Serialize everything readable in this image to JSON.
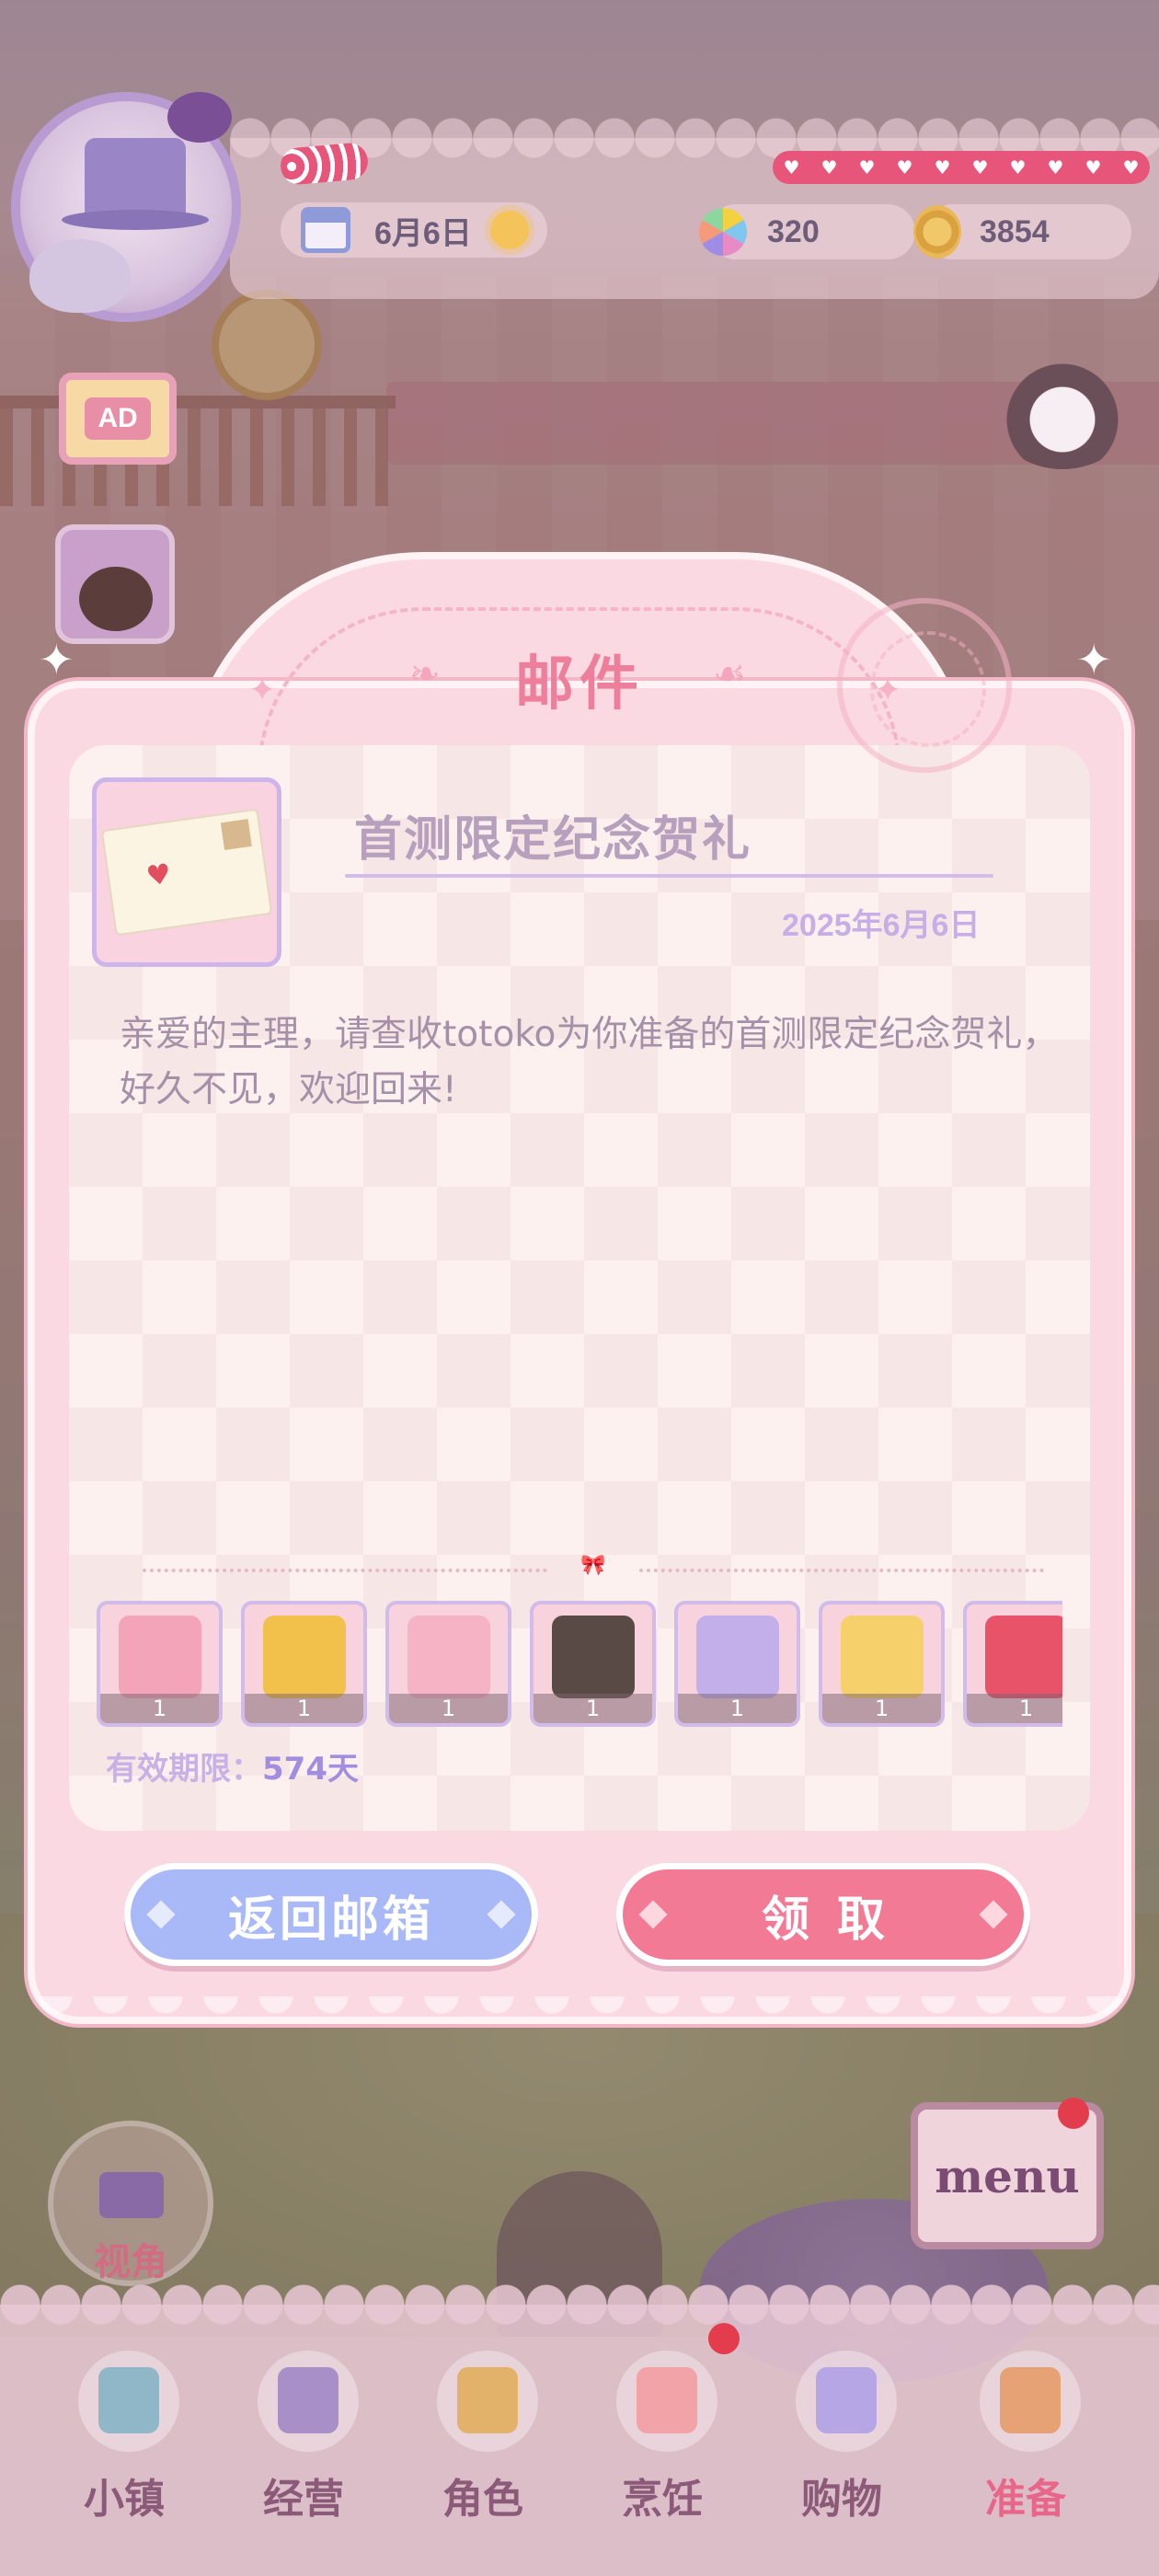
{
  "hud": {
    "date": "6月6日",
    "gems": "320",
    "coins": "3854",
    "ad_label": "AD"
  },
  "mail": {
    "title": "邮件",
    "subject": "首测限定纪念贺礼",
    "date": "2025年6月6日",
    "body": "亲爱的主理，请查收totoko为你准备的首测限定纪念贺礼，好久不见，欢迎回来!",
    "rewards": [
      {
        "icon": "outfit-shop-icon",
        "qty": "1",
        "color": "#f4a4b8"
      },
      {
        "icon": "flower-crown-icon",
        "qty": "1",
        "color": "#f2c14b"
      },
      {
        "icon": "pink-dress-icon",
        "qty": "1",
        "color": "#f6b3c6"
      },
      {
        "icon": "maid-dress-icon",
        "qty": "1",
        "color": "#5a4a45"
      },
      {
        "icon": "lavender-hamster-icon",
        "qty": "1",
        "color": "#c3b0ea"
      },
      {
        "icon": "blonde-avatar-icon",
        "qty": "1",
        "color": "#f6d06a"
      },
      {
        "icon": "strawberry-avatar-icon",
        "qty": "1",
        "color": "#e8536a"
      }
    ],
    "validity_label": "有效期限：",
    "validity_value": "574天",
    "back_button": "返回邮箱",
    "claim_button": "领取"
  },
  "side": {
    "camera_label": "视角",
    "menu_label": "menu"
  },
  "nav": {
    "items": [
      {
        "label": "小镇",
        "icon": "town-map-icon",
        "color": "#8fb7c8"
      },
      {
        "label": "经营",
        "icon": "shop-bag-icon",
        "color": "#a98fc7"
      },
      {
        "label": "角色",
        "icon": "character-icon",
        "color": "#e2b26a"
      },
      {
        "label": "烹饪",
        "icon": "cake-icon",
        "color": "#f2a3a8"
      },
      {
        "label": "购物",
        "icon": "shopping-bag-icon",
        "color": "#b6a6e6"
      },
      {
        "label": "准备",
        "icon": "basket-icon",
        "color": "#e6a175"
      }
    ]
  }
}
